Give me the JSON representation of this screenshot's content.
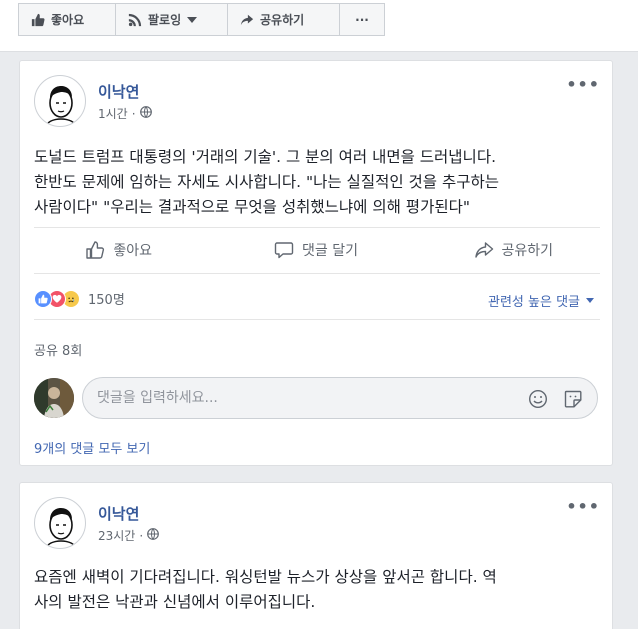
{
  "topbar": {
    "like_label": "좋아요",
    "follow_label": "팔로잉",
    "share_label": "공유하기",
    "more_label": "···"
  },
  "post1": {
    "author": "이낙연",
    "time": "1시간",
    "text_lines": [
      "도널드 트럼프 대통령의 '거래의 기술'. 그 분의 여러 내면을 드러냅니다.",
      "한반도 문제에 임하는 자세도 시사합니다. \"나는 실질적인 것을 추구하는",
      "사람이다\" \"우리는 결과적으로 무엇을 성취했느냐에 의해 평가된다\""
    ],
    "actions": {
      "like": "좋아요",
      "comment": "댓글 달기",
      "share": "공유하기"
    },
    "reaction_count": "150명",
    "sort_label": "관련성 높은 댓글",
    "share_count": "공유 8회",
    "comment_placeholder": "댓글을 입력하세요...",
    "view_all_comments": "9개의 댓글 모두 보기"
  },
  "post2": {
    "author": "이낙연",
    "time": "23시간",
    "text_lines": [
      "요즘엔 새벽이 기다려집니다. 워싱턴발 뉴스가 상상을 앞서곤 합니다. 역",
      "사의 발전은 낙관과 신념에서 이루어집니다."
    ]
  },
  "colors": {
    "link": "#365899",
    "accent": "#4267b2",
    "like_reaction": "#5890ff",
    "love_reaction": "#f25268",
    "sad_reaction": "#f7c94c"
  }
}
